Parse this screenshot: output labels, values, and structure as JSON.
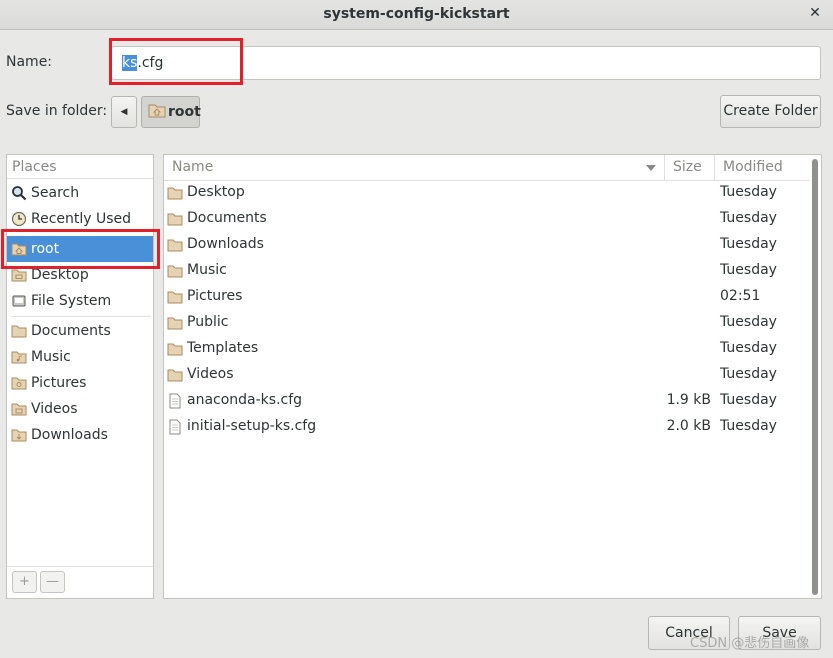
{
  "window": {
    "title": "system-config-kickstart",
    "close_glyph": "✕"
  },
  "name_field": {
    "label": "Name:",
    "selected_text": "ks",
    "rest_text": ".cfg"
  },
  "folder": {
    "label": "Save in folder:",
    "current": "root",
    "back_glyph": "◀"
  },
  "buttons": {
    "create_folder": "Create Folder",
    "cancel": "Cancel",
    "save": "Save",
    "add": "+",
    "remove": "—"
  },
  "places": {
    "header": "Places",
    "items": [
      {
        "label": "Search",
        "icon": "search-icon"
      },
      {
        "label": "Recently Used",
        "icon": "clock-icon"
      },
      {
        "label": "root",
        "icon": "home-folder-icon",
        "selected": true
      },
      {
        "label": "Desktop",
        "icon": "desktop-folder-icon"
      },
      {
        "label": "File System",
        "icon": "drive-icon"
      },
      {
        "label": "Documents",
        "icon": "folder-icon"
      },
      {
        "label": "Music",
        "icon": "music-folder-icon"
      },
      {
        "label": "Pictures",
        "icon": "pictures-folder-icon"
      },
      {
        "label": "Videos",
        "icon": "videos-folder-icon"
      },
      {
        "label": "Downloads",
        "icon": "downloads-folder-icon"
      }
    ]
  },
  "file_list": {
    "columns": {
      "name": "Name",
      "size": "Size",
      "modified": "Modified"
    },
    "rows": [
      {
        "name": "Desktop",
        "size": "",
        "modified": "Tuesday",
        "icon": "folder-icon"
      },
      {
        "name": "Documents",
        "size": "",
        "modified": "Tuesday",
        "icon": "folder-icon"
      },
      {
        "name": "Downloads",
        "size": "",
        "modified": "Tuesday",
        "icon": "folder-icon"
      },
      {
        "name": "Music",
        "size": "",
        "modified": "Tuesday",
        "icon": "folder-icon"
      },
      {
        "name": "Pictures",
        "size": "",
        "modified": "02:51",
        "icon": "folder-icon"
      },
      {
        "name": "Public",
        "size": "",
        "modified": "Tuesday",
        "icon": "folder-icon"
      },
      {
        "name": "Templates",
        "size": "",
        "modified": "Tuesday",
        "icon": "folder-icon"
      },
      {
        "name": "Videos",
        "size": "",
        "modified": "Tuesday",
        "icon": "folder-icon"
      },
      {
        "name": "anaconda-ks.cfg",
        "size": "1.9 kB",
        "modified": "Tuesday",
        "icon": "text-file-icon"
      },
      {
        "name": "initial-setup-ks.cfg",
        "size": "2.0 kB",
        "modified": "Tuesday",
        "icon": "text-file-icon"
      }
    ]
  },
  "watermark": "CSDN @悲伤自画像",
  "colors": {
    "selection": "#4a90d9",
    "highlight_box": "#e0212b"
  }
}
